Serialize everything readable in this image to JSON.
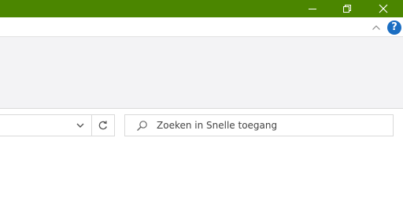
{
  "window": {
    "titlebar_color": "#4b8600",
    "controls": {
      "minimize_icon": "minimize-icon",
      "restore_icon": "restore-icon",
      "close_icon": "close-icon"
    }
  },
  "ribbon": {
    "collapse_icon": "chevron-up-icon",
    "help_label": "?",
    "help_color": "#1b6ec2"
  },
  "address_bar": {
    "value": "",
    "dropdown_icon": "chevron-down-icon",
    "refresh_icon": "refresh-icon"
  },
  "search": {
    "icon": "search-icon",
    "placeholder": "Zoeken in Snelle toegang"
  }
}
